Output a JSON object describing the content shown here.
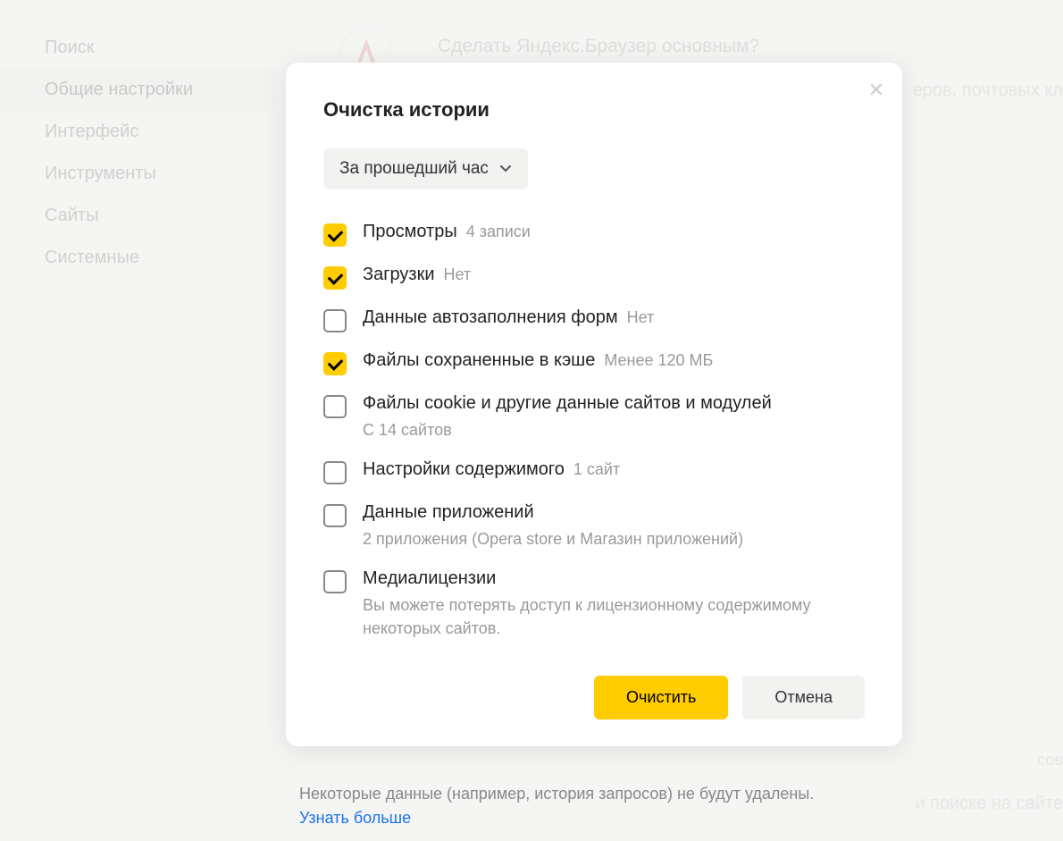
{
  "sidebar": {
    "items": [
      {
        "label": "Поиск"
      },
      {
        "label": "Общие настройки"
      },
      {
        "label": "Интерфейс"
      },
      {
        "label": "Инструменты"
      },
      {
        "label": "Сайты"
      },
      {
        "label": "Системные"
      }
    ]
  },
  "background": {
    "prompt": "Сделать Яндекс.Браузер основным?",
    "right_text": "еров, почтовых кл",
    "bottom_cob": "сов",
    "bottom_right": "и поиске на сайте"
  },
  "modal": {
    "title": "Очистка истории",
    "time_range": "За прошедший час",
    "items": [
      {
        "label": "Просмотры",
        "hint": "4 записи",
        "sublabel": "",
        "checked": true
      },
      {
        "label": "Загрузки",
        "hint": "Нет",
        "sublabel": "",
        "checked": true
      },
      {
        "label": "Данные автозаполнения форм",
        "hint": "Нет",
        "sublabel": "",
        "checked": false
      },
      {
        "label": "Файлы сохраненные в кэше",
        "hint": "Менее 120 МБ",
        "sublabel": "",
        "checked": true
      },
      {
        "label": "Файлы cookie и другие данные сайтов и модулей",
        "hint": "",
        "sublabel": "С 14 сайтов",
        "checked": false
      },
      {
        "label": "Настройки содержимого",
        "hint": "1 сайт",
        "sublabel": "",
        "checked": false
      },
      {
        "label": "Данные приложений",
        "hint": "",
        "sublabel": "2 приложения (Opera store и Магазин приложений)",
        "checked": false
      },
      {
        "label": "Медиалицензии",
        "hint": "",
        "sublabel": "Вы можете потерять доступ к лицензионному содержимому некоторых сайтов.",
        "checked": false
      }
    ],
    "clear_button": "Очистить",
    "cancel_button": "Отмена"
  },
  "footer": {
    "note": "Некоторые данные (например, история запросов) не будут удалены.",
    "link": "Узнать больше"
  }
}
